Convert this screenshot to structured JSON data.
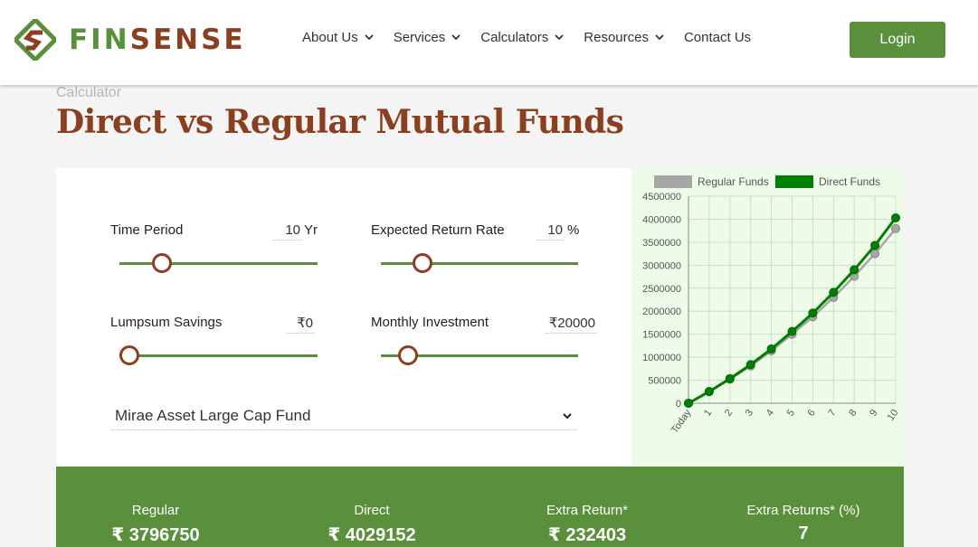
{
  "brand": {
    "name_part1": "FIN",
    "name_part2": "SENSE",
    "green": "#5a8f3c",
    "brown": "#8a3f1f"
  },
  "nav": {
    "items": [
      {
        "label": "About Us",
        "icon": "chevron-down-icon"
      },
      {
        "label": "Services",
        "icon": "chevron-down-icon"
      },
      {
        "label": "Calculators",
        "icon": "chevron-down-icon"
      },
      {
        "label": "Resources",
        "icon": "chevron-down-icon"
      },
      {
        "label": "Contact Us"
      }
    ],
    "login_label": "Login"
  },
  "page": {
    "breadcrumb": "Calculator",
    "title": "Direct vs Regular Mutual Funds"
  },
  "calculator": {
    "time_period": {
      "label": "Time Period",
      "value": "10",
      "unit": "Yr"
    },
    "return_rate": {
      "label": "Expected Return Rate",
      "value": "10",
      "unit": "%"
    },
    "lumpsum": {
      "label": "Lumpsum Savings",
      "value": "₹0"
    },
    "monthly": {
      "label": "Monthly Investment",
      "value": "₹20000"
    },
    "fund_selected": "Mirae Asset Large Cap Fund"
  },
  "chart_data": {
    "type": "line",
    "categories": [
      "Today",
      "1",
      "2",
      "3",
      "4",
      "5",
      "6",
      "7",
      "8",
      "9",
      "10"
    ],
    "series": [
      {
        "name": "Regular Funds",
        "color": "#a6a6a6",
        "values": [
          0,
          250000,
          520000,
          810000,
          1140000,
          1500000,
          1880000,
          2300000,
          2760000,
          3250000,
          3796750
        ]
      },
      {
        "name": "Direct Funds",
        "color": "#008000",
        "values": [
          0,
          255000,
          535000,
          840000,
          1180000,
          1560000,
          1960000,
          2410000,
          2900000,
          3430000,
          4029152
        ]
      }
    ],
    "ylim": [
      0,
      4500000
    ],
    "yticks": [
      "0",
      "500000",
      "1000000",
      "1500000",
      "2000000",
      "2500000",
      "3000000",
      "3500000",
      "4000000",
      "4500000"
    ],
    "grid": true,
    "legend_position": "top"
  },
  "results": [
    {
      "label": "Regular",
      "value": "₹ 3796750"
    },
    {
      "label": "Direct",
      "value": "₹ 4029152"
    },
    {
      "label": "Extra Return*",
      "value": "₹ 232403"
    },
    {
      "label": "Extra Returns* (%)",
      "value": "7"
    }
  ]
}
